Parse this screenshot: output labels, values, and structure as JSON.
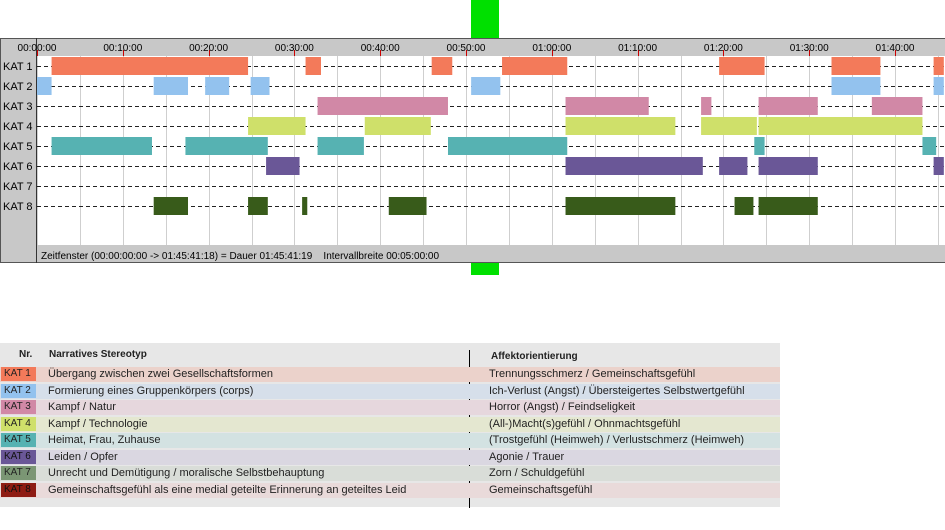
{
  "chart_data": {
    "type": "gantt-timeline",
    "time_unit": "minutes",
    "x_range": [
      0,
      105.69
    ],
    "tick_labels": [
      "00:00:00",
      "00:10:00",
      "00:20:00",
      "00:30:00",
      "00:40:00",
      "00:50:00",
      "01:00:00",
      "01:10:00",
      "01:20:00",
      "01:30:00",
      "01:40:00"
    ],
    "categories": [
      "KAT 1",
      "KAT 2",
      "KAT 3",
      "KAT 4",
      "KAT 5",
      "KAT 6",
      "KAT 7",
      "KAT 8"
    ],
    "series": [
      {
        "category": "KAT 1",
        "color": "#f37a5a",
        "segments": [
          [
            1.7,
            24.6
          ],
          [
            31.3,
            33.1
          ],
          [
            46.0,
            48.4
          ],
          [
            54.2,
            61.8
          ],
          [
            79.5,
            84.8
          ],
          [
            92.6,
            98.3
          ],
          [
            104.5,
            105.69
          ]
        ]
      },
      {
        "category": "KAT 2",
        "color": "#93c2ee",
        "segments": [
          [
            0.0,
            1.7
          ],
          [
            13.6,
            17.6
          ],
          [
            19.6,
            22.4
          ],
          [
            24.9,
            27.1
          ],
          [
            50.6,
            54.0
          ],
          [
            92.6,
            98.3
          ],
          [
            104.5,
            105.69
          ]
        ]
      },
      {
        "category": "KAT 3",
        "color": "#d188a6",
        "segments": [
          [
            32.7,
            47.9
          ],
          [
            61.6,
            71.3
          ],
          [
            77.4,
            78.6
          ],
          [
            84.1,
            91.0
          ],
          [
            97.3,
            103.2
          ]
        ]
      },
      {
        "category": "KAT 4",
        "color": "#cfe06a",
        "segments": [
          [
            24.6,
            31.3
          ],
          [
            38.2,
            45.9
          ],
          [
            61.6,
            74.4
          ],
          [
            77.4,
            83.9
          ],
          [
            84.1,
            103.2
          ]
        ]
      },
      {
        "category": "KAT 5",
        "color": "#56b2b2",
        "segments": [
          [
            1.7,
            13.4
          ],
          [
            17.3,
            26.9
          ],
          [
            32.7,
            38.1
          ],
          [
            47.9,
            61.8
          ],
          [
            83.6,
            84.8
          ],
          [
            103.2,
            104.8
          ]
        ]
      },
      {
        "category": "KAT 6",
        "color": "#6a5797",
        "segments": [
          [
            26.7,
            30.6
          ],
          [
            61.6,
            77.6
          ],
          [
            79.5,
            82.8
          ],
          [
            84.1,
            91.0
          ],
          [
            104.5,
            105.69
          ]
        ]
      },
      {
        "category": "KAT 7",
        "color": "#7b9674",
        "segments": []
      },
      {
        "category": "KAT 8",
        "color": "#385b1a",
        "segments": [
          [
            13.6,
            17.6
          ],
          [
            24.6,
            26.9
          ],
          [
            30.9,
            31.5
          ],
          [
            41.0,
            45.4
          ],
          [
            61.6,
            74.4
          ],
          [
            81.3,
            83.5
          ],
          [
            84.1,
            91.0
          ]
        ]
      }
    ],
    "title": "",
    "xlabel": "",
    "ylabel": "",
    "grid": true
  },
  "timeline": {
    "status_text": "Zeitfenster (00:00:00:00 -> 01:45:41:18) = Dauer 01:45:41:19    Intervallbreite 00:05:00:00",
    "panel_bg": "#c8c8c8",
    "plot_bg": "#ffffff",
    "cursor_color": "#00e000"
  },
  "legend": {
    "header": {
      "nr": "Nr.",
      "stereotype": "Narratives Stereotyp",
      "affect": "Affektorientierung"
    },
    "rows": [
      {
        "code": "KAT 1",
        "stereotype": "Übergang zwischen zwei Gesellschaftsformen",
        "affect": "Trennungsschmerz / Gemeinschaftsgefühl",
        "color": "#f37a5a",
        "tint": "#ebd2cb"
      },
      {
        "code": "KAT 2",
        "stereotype": "Formierung eines Gruppenkörpers (corps)",
        "affect": "Ich-Verlust (Angst) / Übersteigertes Selbstwertgefühl",
        "color": "#93c2ee",
        "tint": "#d6dfea"
      },
      {
        "code": "KAT 3",
        "stereotype": "Kampf / Natur",
        "affect": "Horror (Angst) / Feindseligkeit",
        "color": "#d188a6",
        "tint": "#e6d7dd"
      },
      {
        "code": "KAT 4",
        "stereotype": "Kampf / Technologie",
        "affect": "(All-)Macht(s)gefühl / Ohnmachtsgefühl",
        "color": "#cfe06a",
        "tint": "#e4e7d0"
      },
      {
        "code": "KAT 5",
        "stereotype": "Heimat, Frau, Zuhause",
        "affect": "(Trostgefühl (Heimweh) / Verlustschmerz (Heimweh)",
        "color": "#56b2b2",
        "tint": "#d3e2e2"
      },
      {
        "code": "KAT 6",
        "stereotype": "Leiden / Opfer",
        "affect": "Agonie / Trauer",
        "color": "#6a5797",
        "tint": "#dad7e1"
      },
      {
        "code": "KAT 7",
        "stereotype": "Unrecht und Demütigung / moralische Selbstbehauptung",
        "affect": "Zorn / Schuldgefühl",
        "color": "#7b9674",
        "tint": "#d9ddd8"
      },
      {
        "code": "KAT 8",
        "stereotype": "Gemeinschaftsgefühl als eine medial geteilte Erinnerung an geteiltes Leid",
        "affect": "Gemeinschaftsgefühl",
        "color": "#8e1c14",
        "tint": "#e9dada"
      }
    ]
  }
}
